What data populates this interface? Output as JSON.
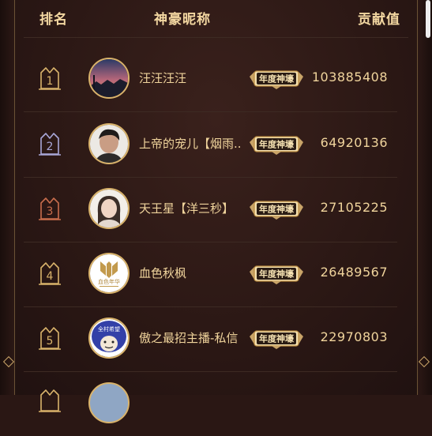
{
  "header": {
    "rank": "排名",
    "nickname": "神豪昵称",
    "contribution": "贡献值"
  },
  "badge_text": "年度神壕",
  "rows": [
    {
      "rank": "1",
      "name": "汪汪汪汪",
      "score": "103885408",
      "crown_color": "#d9b36b",
      "avatar": "night-sky-photo"
    },
    {
      "rank": "2",
      "name": "上帝的宠儿【烟雨..",
      "score": "64920136",
      "crown_color": "#a9a7d8",
      "avatar": "man-portrait-photo"
    },
    {
      "rank": "3",
      "name": "天王星【洋三秒】",
      "score": "27105225",
      "crown_color": "#c96e4d",
      "avatar": "woman-portrait-photo"
    },
    {
      "rank": "4",
      "name": "血色秋枫",
      "score": "26489567",
      "crown_color": "#d9b36b",
      "avatar": "gold-logo",
      "avatar_text": "血色年华"
    },
    {
      "rank": "5",
      "name": "傲之最招主播-私信",
      "score": "22970803",
      "crown_color": "#d9b36b",
      "avatar": "cartoon-face",
      "avatar_text": "全村希望"
    }
  ]
}
